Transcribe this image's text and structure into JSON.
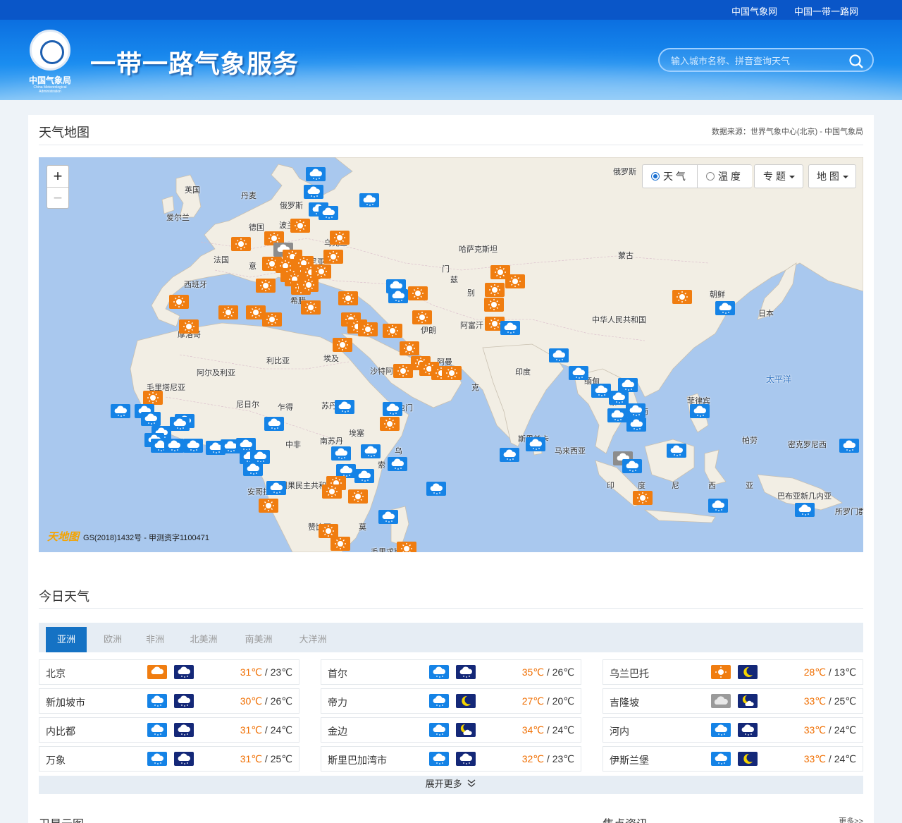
{
  "top_links": [
    "中国气象网",
    "中国一带一路网"
  ],
  "logo": {
    "name": "中国气象局",
    "subtitle": "China Meteorological Administration"
  },
  "site_title": "一带一路气象服务",
  "search": {
    "placeholder": "输入城市名称、拼音查询天气"
  },
  "map_section": {
    "title": "天气地图",
    "source": "数据来源：世界气象中心(北京) - 中国气象局"
  },
  "map": {
    "zoom_in": "+",
    "zoom_out": "−",
    "controls": {
      "weather": "天 气",
      "temperature": "温 度",
      "topic": "专 题",
      "map": "地 图"
    },
    "credit": "GS(2018)1432号 - 甲测资字1100471",
    "credit_logo": "天地图",
    "labels": [
      "英国",
      "丹麦",
      "俄罗斯",
      "俄罗斯",
      "爱尔兰",
      "德国",
      "波兰",
      "法国",
      "意",
      "乌克兰",
      "马尼亚",
      "西班牙",
      "希腊",
      "摩洛哥",
      "利比亚",
      "埃及",
      "阿尔及利亚",
      "沙特阿",
      "伊朗",
      "阿富汗",
      "哈萨克斯坦",
      "蒙古",
      "中华人民共和国",
      "朝鲜",
      "日本",
      "印度",
      "缅甸",
      "泰",
      "南",
      "菲律宾",
      "太平洋",
      "毛里塔尼亚",
      "尼日尔",
      "乍得",
      "苏丹",
      "中非",
      "南苏丹",
      "刚果民主共和",
      "安哥拉",
      "赞比亚",
      "莫",
      "斯里兰卡",
      "马来西亚",
      "帕劳",
      "印",
      "度",
      "尼",
      "西",
      "亚",
      "巴布亚新几内亚",
      "所罗门群",
      "密克罗尼西",
      "毛里求斯",
      "埃塞",
      "乌",
      "索",
      "也门",
      "阿曼",
      "克",
      "别",
      "兹",
      "门"
    ],
    "ocean_label": "太平洋",
    "marker_colors": {
      "sun": "#f07d10",
      "rain": "#1583e6",
      "cloud": "#8c8c8c"
    }
  },
  "today": {
    "title": "今日天气",
    "tabs": [
      "亚洲",
      "欧洲",
      "非洲",
      "北美洲",
      "南美洲",
      "大洋洲"
    ],
    "cities": [
      {
        "name": "北京",
        "day": "sun-cloud",
        "night": "rain",
        "hi": "31℃",
        "lo": "23℃"
      },
      {
        "name": "首尔",
        "day": "rain",
        "night": "rain",
        "hi": "35℃",
        "lo": "26℃"
      },
      {
        "name": "乌兰巴托",
        "day": "sun",
        "night": "moon",
        "hi": "28℃",
        "lo": "13℃"
      },
      {
        "name": "新加坡市",
        "day": "rain",
        "night": "rain",
        "hi": "30℃",
        "lo": "26℃"
      },
      {
        "name": "帝力",
        "day": "rain",
        "night": "moon",
        "hi": "27℃",
        "lo": "20℃"
      },
      {
        "name": "吉隆坡",
        "day": "cloud",
        "night": "moon-cloud",
        "hi": "33℃",
        "lo": "25℃"
      },
      {
        "name": "内比都",
        "day": "rain",
        "night": "rain",
        "hi": "31℃",
        "lo": "24℃"
      },
      {
        "name": "金边",
        "day": "rain",
        "night": "moon-cloud",
        "hi": "34℃",
        "lo": "24℃"
      },
      {
        "name": "河内",
        "day": "rain",
        "night": "rain",
        "hi": "33℃",
        "lo": "24℃"
      },
      {
        "name": "万象",
        "day": "rain",
        "night": "rain",
        "hi": "31℃",
        "lo": "25℃"
      },
      {
        "name": "斯里巴加湾市",
        "day": "rain",
        "night": "rain",
        "hi": "32℃",
        "lo": "23℃"
      },
      {
        "name": "伊斯兰堡",
        "day": "rain",
        "night": "moon",
        "hi": "33℃",
        "lo": "24℃"
      }
    ],
    "more": "展开更多"
  },
  "bottom": {
    "satellite": "卫星云图",
    "focus": "焦点资讯",
    "more": "更多>>"
  }
}
